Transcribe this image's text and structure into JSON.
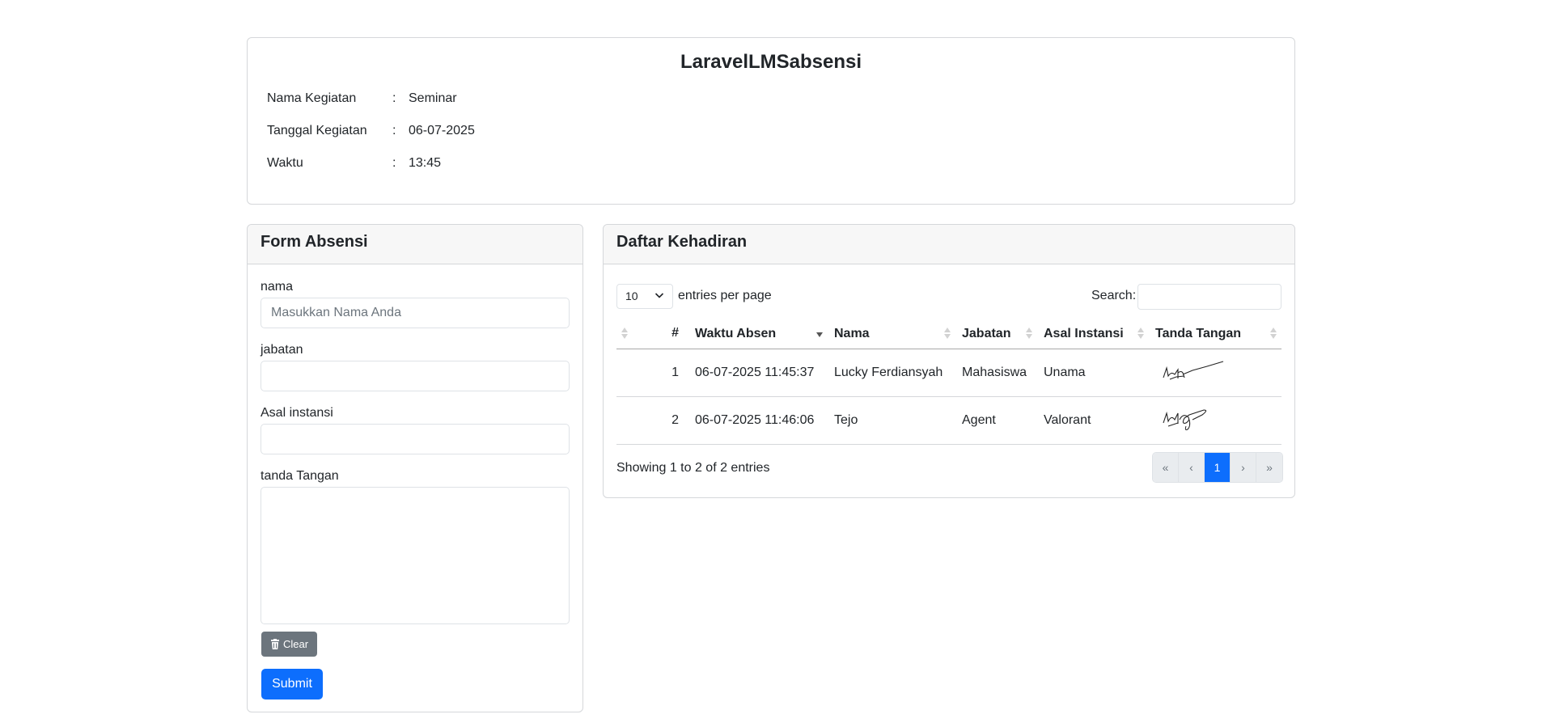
{
  "app_title": "LaravelLMSabsensi",
  "event": {
    "rows": [
      {
        "label": "Nama Kegiatan",
        "value": "Seminar"
      },
      {
        "label": "Tanggal Kegiatan",
        "value": "06-07-2025"
      },
      {
        "label": "Waktu",
        "value": "13:45"
      }
    ],
    "separator": ":"
  },
  "form": {
    "title": "Form Absensi",
    "nama_label": "nama",
    "nama_placeholder": "Masukkan Nama Anda",
    "jabatan_label": "jabatan",
    "instansi_label": "Asal instansi",
    "ttd_label": "tanda Tangan",
    "clear_label": "Clear",
    "submit_label": "Submit"
  },
  "list": {
    "title": "Daftar Kehadiran",
    "page_length": "10",
    "entries_label": "entries per page",
    "search_label": "Search:",
    "columns": [
      "#",
      "Waktu Absen",
      "Nama",
      "Jabatan",
      "Asal Instansi",
      "Tanda Tangan"
    ],
    "rows": [
      {
        "no": "1",
        "waktu": "06-07-2025 11:45:37",
        "nama": "Lucky Ferdiansyah",
        "jabatan": "Mahasiswa",
        "instansi": "Unama"
      },
      {
        "no": "2",
        "waktu": "06-07-2025 11:46:06",
        "nama": "Tejo",
        "jabatan": "Agent",
        "instansi": "Valorant"
      }
    ],
    "info": "Showing 1 to 2 of 2 entries",
    "pagination": [
      "«",
      "‹",
      "1",
      "›",
      "»"
    ],
    "active_page": "1"
  },
  "colors": {
    "primary": "#0d6efd",
    "secondary": "#6c757d"
  },
  "icons": {
    "clear": "trash-icon",
    "length": "chevron-down-icon"
  }
}
